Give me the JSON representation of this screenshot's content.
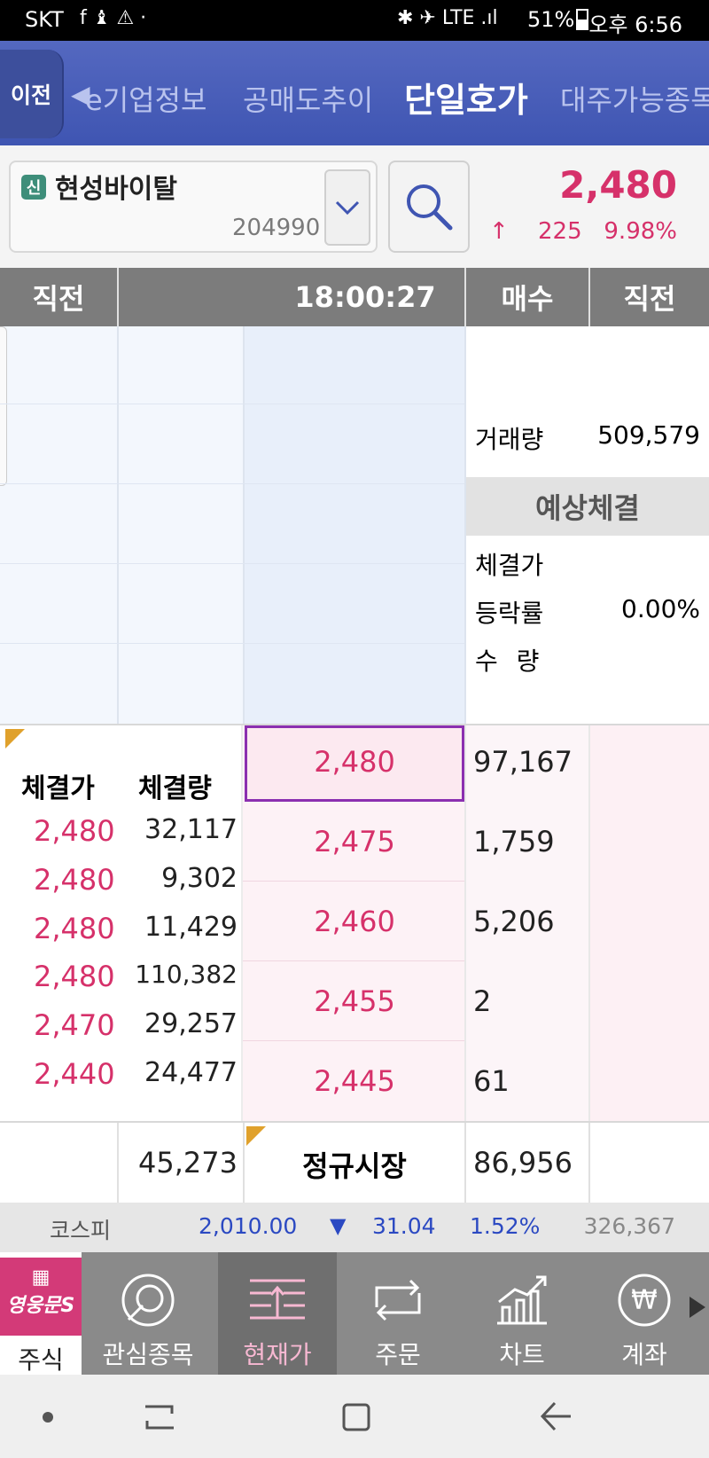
{
  "status": {
    "carrier": "SKT",
    "left_icons": "f ♝ ⚠ ·",
    "right_icons": "✱ ✈ LTE .ıl",
    "battery": "51%",
    "time": "오후 6:56"
  },
  "tabs": {
    "prev": "이전",
    "items": [
      "e기업정보",
      "공매도추이",
      "단일호가",
      "대주가능종목"
    ],
    "active": "단일호가"
  },
  "stock": {
    "badge": "신",
    "name": "현성바이탈",
    "code": "204990",
    "price": "2,480",
    "arrow": "↑",
    "change": "225",
    "rate": "9.98%"
  },
  "header": {
    "col1": "직전",
    "time": "18:00:27",
    "col4": "매수",
    "col5": "직전"
  },
  "summary": {
    "volume_label": "거래량",
    "volume": "509,579",
    "expected_header": "예상체결",
    "exp_price_label": "체결가",
    "exp_rate_label": "등락률",
    "exp_rate": "0.00%",
    "exp_qty_label": "수 량"
  },
  "trades": {
    "price_header": "체결가",
    "qty_header": "체결량",
    "rows": [
      {
        "price": "2,480",
        "qty": "32,117"
      },
      {
        "price": "2,480",
        "qty": "9,302"
      },
      {
        "price": "2,480",
        "qty": "11,429"
      },
      {
        "price": "2,480",
        "qty": "110,382"
      },
      {
        "price": "2,470",
        "qty": "29,257"
      },
      {
        "price": "2,440",
        "qty": "24,477"
      }
    ]
  },
  "bids": [
    {
      "price": "2,480",
      "qty": "97,167"
    },
    {
      "price": "2,475",
      "qty": "1,759"
    },
    {
      "price": "2,460",
      "qty": "5,206"
    },
    {
      "price": "2,455",
      "qty": "2"
    },
    {
      "price": "2,445",
      "qty": "61"
    }
  ],
  "totals": {
    "sell": "45,273",
    "market": "정규시장",
    "buy": "86,956"
  },
  "kospi": {
    "label": "코스피",
    "value": "2,010.00",
    "arrow": "▼",
    "change": "31.04",
    "rate": "1.52%",
    "volume": "326,367"
  },
  "nav": {
    "brand": "영웅문S",
    "items": [
      "주식",
      "관심종목",
      "현재가",
      "주문",
      "차트",
      "계좌"
    ],
    "active": "현재가"
  },
  "colors": {
    "up": "#d6316a",
    "down": "#2b49c2",
    "header": "#3f55b2"
  }
}
